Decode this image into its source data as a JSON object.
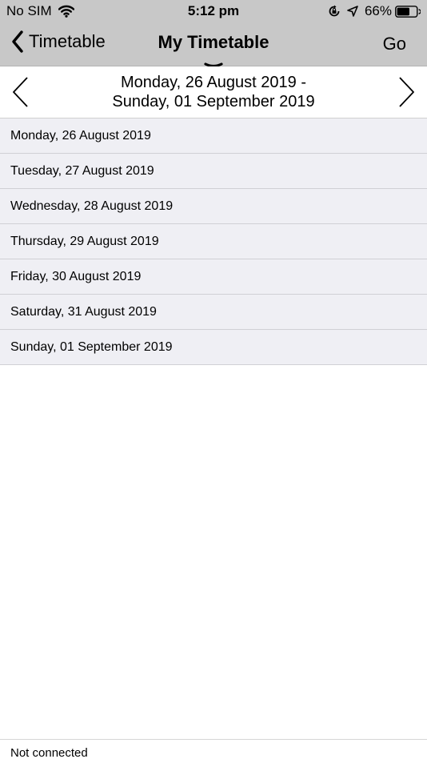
{
  "status_bar": {
    "carrier": "No SIM",
    "time": "5:12 pm",
    "battery": "66%",
    "battery_level": 0.66,
    "icons": [
      "wifi-icon",
      "orientation-lock-icon",
      "location-arrow-icon",
      "battery-icon"
    ]
  },
  "nav": {
    "back_label": "Timetable",
    "title": "My Timetable",
    "go_label": "Go",
    "icons": [
      "chevron-left-icon",
      "pull-handle-icon"
    ]
  },
  "week": {
    "range_start": "Monday, 26 August 2019 -",
    "range_end": "Sunday, 01 September 2019",
    "icons": [
      "prev-week-icon",
      "next-week-icon"
    ]
  },
  "days": [
    "Monday, 26 August 2019",
    "Tuesday, 27 August 2019",
    "Wednesday, 28 August 2019",
    "Thursday, 29 August 2019",
    "Friday, 30 August 2019",
    "Saturday, 31 August 2019",
    "Sunday, 01 September 2019"
  ],
  "footer": {
    "status": "Not connected"
  },
  "colors": {
    "nav_background": "#c8c8c8",
    "row_background": "#efeff4",
    "divider": "#d0d0d5"
  }
}
